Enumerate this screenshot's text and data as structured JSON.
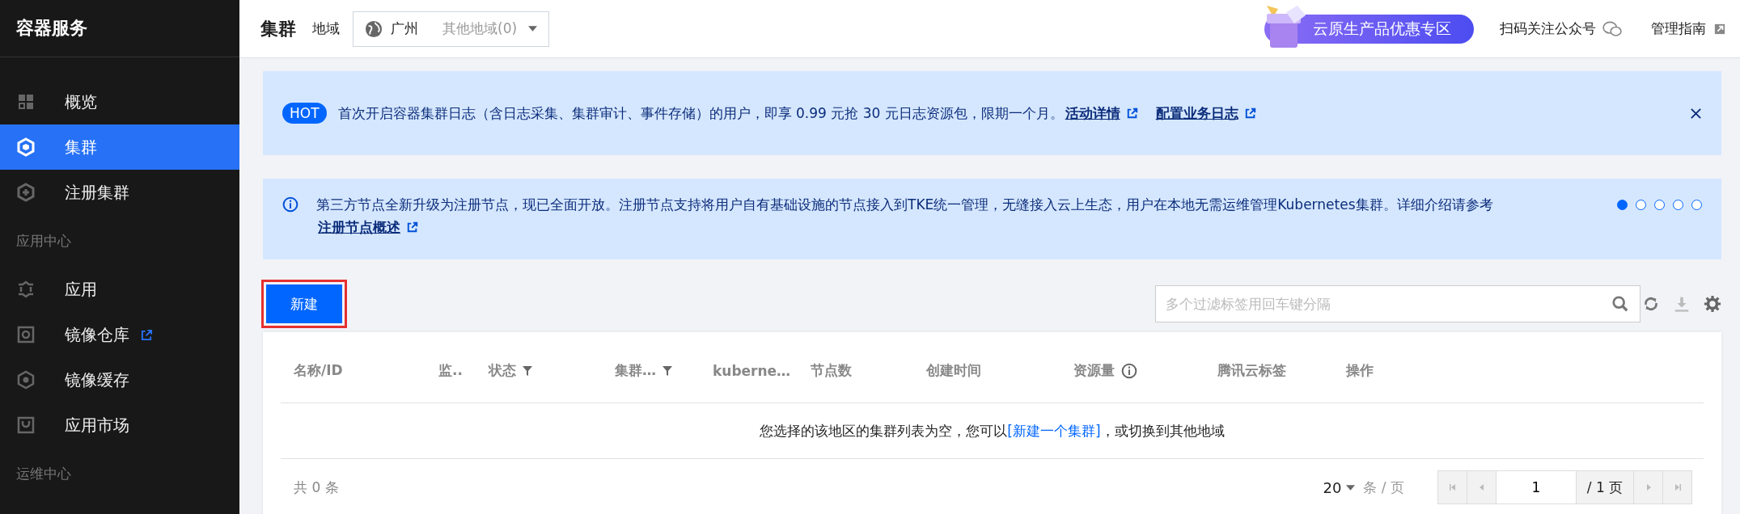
{
  "sidebar": {
    "title": "容器服务",
    "items": [
      {
        "label": "概览",
        "selected": false,
        "external": false
      },
      {
        "label": "集群",
        "selected": true,
        "external": false
      },
      {
        "label": "注册集群",
        "selected": false,
        "external": false
      }
    ],
    "sections": [
      {
        "heading": "应用中心",
        "items": [
          {
            "label": "应用",
            "selected": false,
            "external": false
          },
          {
            "label": "镜像仓库",
            "selected": false,
            "external": true
          },
          {
            "label": "镜像缓存",
            "selected": false,
            "external": false
          },
          {
            "label": "应用市场",
            "selected": false,
            "external": false
          }
        ]
      },
      {
        "heading": "运维中心"
      }
    ]
  },
  "header": {
    "title": "集群",
    "region_label": "地域",
    "region": {
      "value": "广州",
      "other": "其他地域(0)"
    },
    "promo": "云原生产品优惠专区",
    "follow": "扫码关注公众号",
    "guide": "管理指南"
  },
  "notices": [
    {
      "kind": "hot",
      "badge": "HOT",
      "text": "首次开启容器集群日志（含日志采集、集群审计、事件存储）的用户，即享 0.99 元抢 30 元日志资源包，限期一个月。",
      "links": [
        "活动详情",
        "配置业务日志"
      ],
      "closable": true
    },
    {
      "kind": "info",
      "text": "第三方节点全新升级为注册节点，现已全面开放。注册节点支持将用户自有基础设施的节点接入到TKE统一管理，无缝接入云上生态，用户在本地无需运维管理Kubernetes集群。详细介绍请参考",
      "links": [
        "注册节点概述"
      ],
      "dots": [
        {
          "selected": true
        },
        {
          "selected": false
        },
        {
          "selected": false
        },
        {
          "selected": false
        },
        {
          "selected": false
        }
      ]
    }
  ],
  "toolbar": {
    "new_button": "新建",
    "search": {
      "placeholder": "多个过滤标签用回车键分隔"
    }
  },
  "table": {
    "columns": [
      {
        "label": "名称/ID",
        "filter": false,
        "info": false
      },
      {
        "label": "监..",
        "filter": false,
        "info": false
      },
      {
        "label": "状态",
        "filter": true,
        "info": false
      },
      {
        "label": "集群…",
        "filter": true,
        "info": false
      },
      {
        "label": "kuberne…",
        "filter": false,
        "info": false
      },
      {
        "label": "节点数",
        "filter": false,
        "info": false
      },
      {
        "label": "创建时间",
        "filter": false,
        "info": false
      },
      {
        "label": "资源量",
        "filter": false,
        "info": true
      },
      {
        "label": "腾讯云标签",
        "filter": false,
        "info": false
      },
      {
        "label": "操作",
        "filter": false,
        "info": false
      }
    ],
    "empty": {
      "before": "您选择的该地区的集群列表为空，您可以",
      "link": "[新建一个集群]",
      "after": "，或切换到其他地域"
    },
    "footer": {
      "total": "共 0 条",
      "page_size": "20",
      "per_page": "条 / 页",
      "page": "1",
      "pages": "/ 1 页"
    }
  }
}
